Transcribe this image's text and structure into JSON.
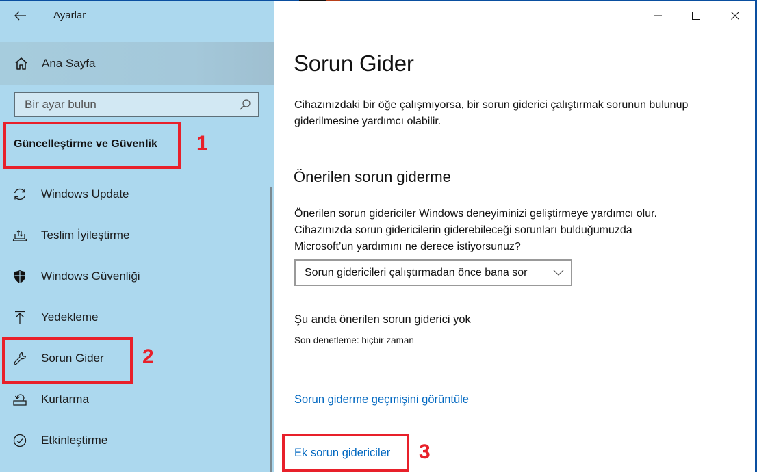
{
  "window": {
    "app_title": "Ayarlar",
    "controls": {
      "minimize_icon": "minimize-icon",
      "maximize_icon": "maximize-icon",
      "close_icon": "close-icon"
    }
  },
  "sidebar": {
    "back_icon": "back-arrow-icon",
    "home": {
      "label": "Ana Sayfa",
      "icon": "home-icon"
    },
    "search": {
      "placeholder": "Bir ayar bulun",
      "value": "",
      "icon": "search-icon"
    },
    "section_title": "Güncelleştirme ve Güvenlik",
    "items": [
      {
        "label": "Windows Update",
        "icon": "sync-icon"
      },
      {
        "label": "Teslim İyileştirme",
        "icon": "delivery-optimization-icon"
      },
      {
        "label": "Windows Güvenliği",
        "icon": "shield-icon"
      },
      {
        "label": "Yedekleme",
        "icon": "backup-arrow-up-icon"
      },
      {
        "label": "Sorun Gider",
        "icon": "wrench-icon",
        "selected": true
      },
      {
        "label": "Kurtarma",
        "icon": "recovery-icon"
      },
      {
        "label": "Etkinleştirme",
        "icon": "check-circle-icon"
      }
    ]
  },
  "main": {
    "title": "Sorun Gider",
    "intro": "Cihazınızdaki bir öğe çalışmıyorsa, bir sorun giderici çalıştırmak sorunun bulunup giderilmesine yardımcı olabilir.",
    "recommended": {
      "heading": "Önerilen sorun giderme",
      "description": "Önerilen sorun gidericiler Windows deneyiminizi geliştirmeye yardımcı olur. Cihazınızda sorun gidericilerin giderebileceği sorunları bulduğumuzda Microsoft’un yardımını ne derece istiyorsunuz?",
      "dropdown_value": "Sorun gidericileri çalıştırmadan önce bana sor",
      "status": "Şu anda önerilen sorun giderici yok",
      "last_check": "Son denetleme: hiçbir zaman"
    },
    "links": {
      "history": "Sorun giderme geçmişini görüntüle",
      "additional": "Ek sorun gidericiler"
    }
  },
  "annotations": [
    {
      "number": "1",
      "target": "Güncelleştirme ve Güvenlik",
      "color": "#e8202a"
    },
    {
      "number": "2",
      "target": "Sorun Gider",
      "color": "#e8202a"
    },
    {
      "number": "3",
      "target": "Ek sorun gidericiler",
      "color": "#e8202a"
    }
  ],
  "colors": {
    "sidebar_bg": "#acd8ee",
    "link": "#0067c0",
    "annotation": "#e8202a",
    "window_border": "#0a4fa0"
  }
}
